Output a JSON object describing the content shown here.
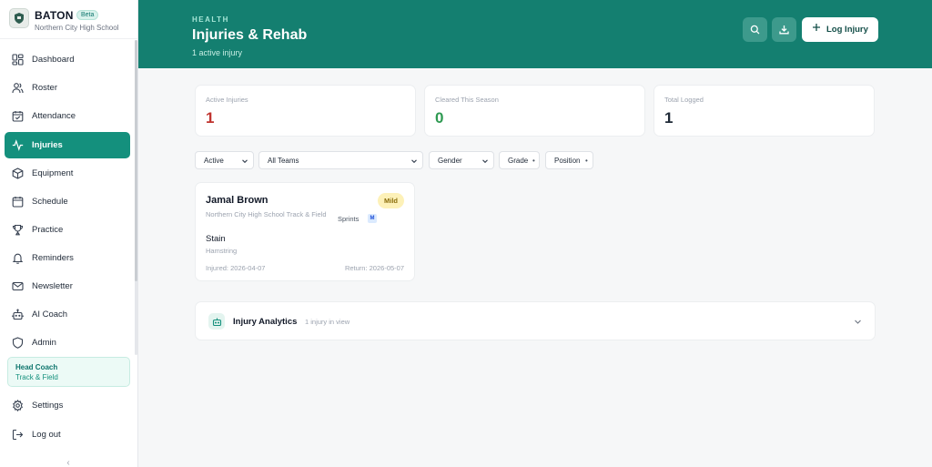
{
  "brand": {
    "name": "BATON",
    "badge": "Beta",
    "school": "Northern City High School"
  },
  "nav": [
    {
      "label": "Dashboard",
      "icon": "dashboard-icon",
      "active": false
    },
    {
      "label": "Roster",
      "icon": "users-icon",
      "active": false
    },
    {
      "label": "Attendance",
      "icon": "calendar-check-icon",
      "active": false
    },
    {
      "label": "Injuries",
      "icon": "activity-icon",
      "active": true
    },
    {
      "label": "Equipment",
      "icon": "box-icon",
      "active": false
    },
    {
      "label": "Schedule",
      "icon": "calendar-icon",
      "active": false
    },
    {
      "label": "Practice",
      "icon": "trophy-icon",
      "active": false
    },
    {
      "label": "Reminders",
      "icon": "bell-icon",
      "active": false
    },
    {
      "label": "Newsletter",
      "icon": "mail-icon",
      "active": false
    },
    {
      "label": "AI Coach",
      "icon": "bot-icon",
      "active": false
    },
    {
      "label": "Admin",
      "icon": "shield-icon",
      "active": false
    }
  ],
  "role": {
    "title": "Head Coach",
    "sport": "Track & Field"
  },
  "footer_nav": {
    "settings": "Settings",
    "logout": "Log out"
  },
  "header": {
    "eyebrow": "HEALTH",
    "title": "Injuries & Rehab",
    "subtitle": "1 active injury",
    "log_button": "Log Injury"
  },
  "stats": [
    {
      "label": "Active Injuries",
      "value": "1",
      "color": "#c0342f"
    },
    {
      "label": "Cleared This Season",
      "value": "0",
      "color": "#2f9a52"
    },
    {
      "label": "Total Logged",
      "value": "1",
      "color": "#1f2a37"
    }
  ],
  "filters": {
    "status": "Active",
    "team": "All Teams",
    "gender": "Gender",
    "grade": "Grade",
    "position": "Position"
  },
  "injury": {
    "athlete": "Jamal Brown",
    "school": "Northern City High School Track & Field",
    "severity": "Mild",
    "event": "Sprints",
    "gender": "M",
    "type": "Stain",
    "body_part": "Hamstring",
    "injured": "Injured: 2026-04-07",
    "return": "Return: 2026-05-07"
  },
  "analytics": {
    "title": "Injury Analytics",
    "count": "1 injury in view"
  },
  "colors": {
    "accent": "#14907d",
    "header": "#147f70"
  }
}
